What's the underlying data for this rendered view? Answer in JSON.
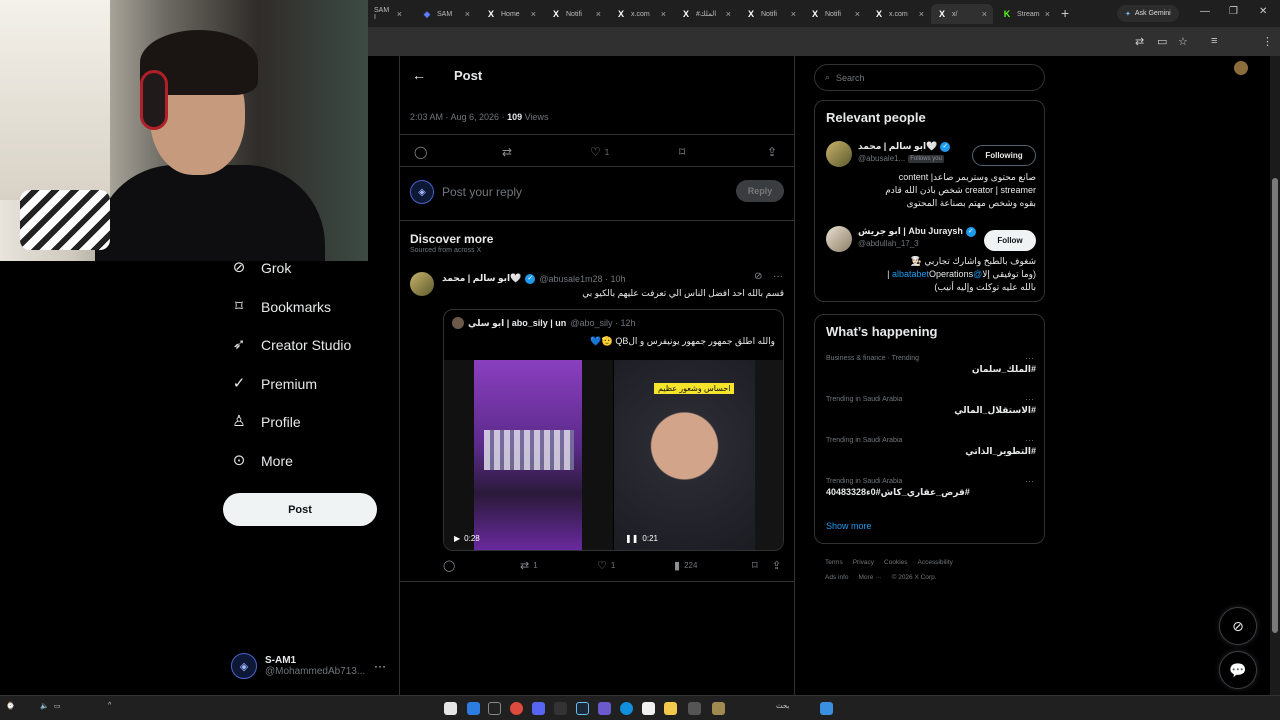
{
  "browser": {
    "tabs": [
      {
        "label": "SAM I",
        "fav": "•"
      },
      {
        "label": "SAM",
        "fav": "◆"
      },
      {
        "label": "Home",
        "fav": "X"
      },
      {
        "label": "Notifi",
        "fav": "X"
      },
      {
        "label": "x.com",
        "fav": "X"
      },
      {
        "label": "#الملك",
        "fav": "X"
      },
      {
        "label": "Notifi",
        "fav": "X"
      },
      {
        "label": "Notifi",
        "fav": "X"
      },
      {
        "label": "x.com",
        "fav": "X"
      },
      {
        "label": "x/",
        "fav": "X"
      },
      {
        "label": "Stream",
        "fav": "K"
      }
    ],
    "ask_gemini": "Ask Gemini"
  },
  "nav": {
    "items": [
      {
        "label": "Grok",
        "icon": "grok-icon"
      },
      {
        "label": "Bookmarks",
        "icon": "bookmark-icon"
      },
      {
        "label": "Creator Studio",
        "icon": "rocket-icon"
      },
      {
        "label": "Premium",
        "icon": "verified-icon"
      },
      {
        "label": "Profile",
        "icon": "person-icon"
      },
      {
        "label": "More",
        "icon": "more-circle-icon"
      }
    ],
    "post_button": "Post",
    "account": {
      "name": "S-AM1",
      "handle": "@MohammedAb713...",
      "more": "···"
    }
  },
  "post": {
    "header_title": "Post",
    "time": "2:03 AM · Aug 6, 2026 · ",
    "views_count": "109",
    "views_label": " Views",
    "likes": "1",
    "reply_placeholder": "Post your reply",
    "reply_button": "Reply"
  },
  "discover": {
    "title": "Discover more",
    "subtitle": "Sourced from across X",
    "tweet": {
      "name": "ابو سالم | محمد🤍",
      "handle": "@abusale1m28 · 10h",
      "text": "قسم بالله احد افضل الناس الي تعرفت عليهم بالكيو بي",
      "quote": {
        "name": "ابو سلي | abo_sily | un",
        "handle": "@abo_sily · 12h",
        "text": "والله اطلق جمهور جمهور يونيفرس و الQB 🫡💙",
        "media1_duration": "0:28",
        "media2_duration": "0:21",
        "media2_caption": "احساس وشعور عظيم"
      },
      "replies": "",
      "reposts": "1",
      "likes": "1",
      "views": "224"
    }
  },
  "sidebar": {
    "search_placeholder": "Search",
    "relevant_title": "Relevant people",
    "people": [
      {
        "name": "ابو سالم | محمد🤍",
        "handle": "@abusale1...",
        "follows_you": "Follows you",
        "button": "Following",
        "bio_lines": [
          "صانع محتوى وستريمر صاعد| content",
          "creator | streamer شخص باذن الله قادم",
          "بقوه وشخص مهتم بصناعة المحتوى"
        ]
      },
      {
        "name": "ابو جريش | Abu Juraysh",
        "handle": "@abdullah_17_3",
        "button": "Follow",
        "bio_line1": "شغوف بالطبخ واشارك تجاربي 👨🏻‍🍳",
        "bio_line2_pre": "Operations | ",
        "bio_line2_link": "@albatabet",
        "bio_line2_post": " (وما توفيقي إلا",
        "bio_line3": "بالله عليه توكلت وإليه أنيب)"
      }
    ],
    "happening_title": "What’s happening",
    "trends": [
      {
        "category": "Business & finance · Trending",
        "tag": "#الملك_سلمان"
      },
      {
        "category": "Trending in Saudi Arabia",
        "tag": "#الاستقلال_المالي"
      },
      {
        "category": "Trending in Saudi Arabia",
        "tag": "#التطوير_الذاتي"
      },
      {
        "category": "Trending in Saudi Arabia",
        "tag": "#قرض_عقاري_كاش#0ء40483328"
      }
    ],
    "show_more": "Show more",
    "footer_row1": [
      "Terms",
      "Privacy",
      "Cookies",
      "Accessibility"
    ],
    "footer_row2": [
      "Ads info",
      "More ···",
      "© 2026 X Corp."
    ]
  },
  "taskbar": {
    "search": "بحث"
  }
}
